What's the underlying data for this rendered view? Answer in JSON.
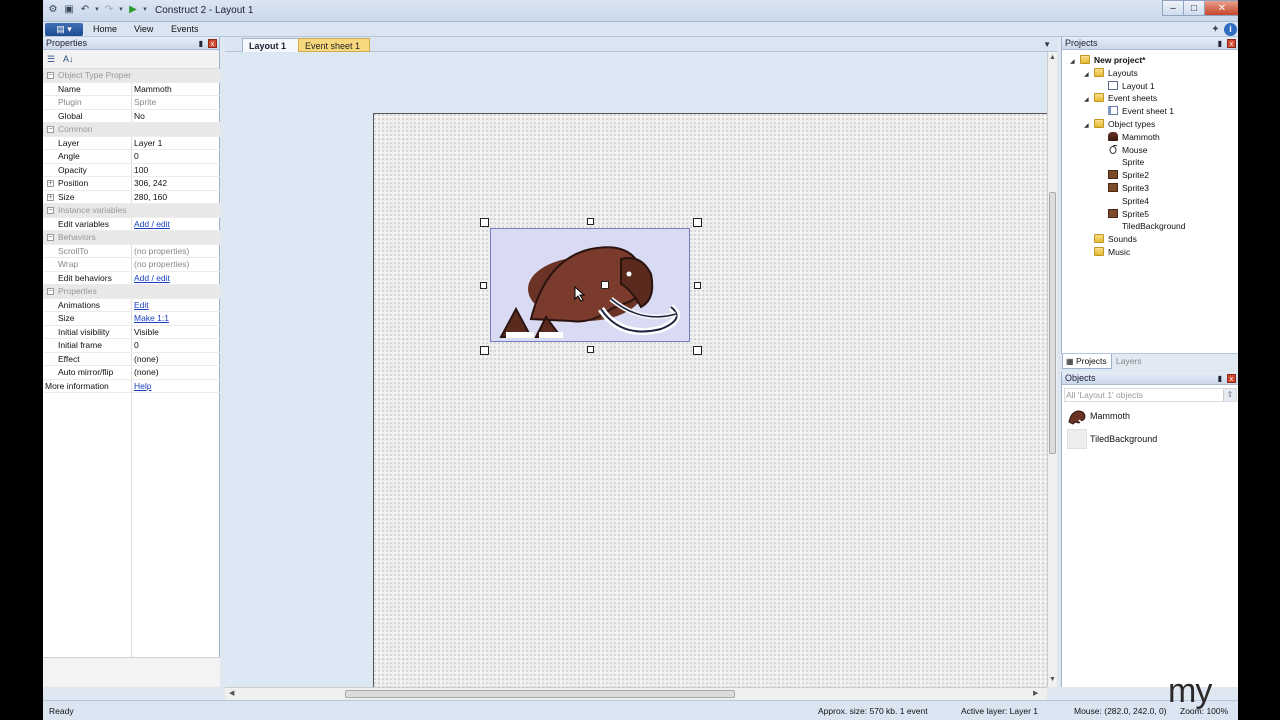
{
  "window": {
    "title": "Construct 2 - Layout 1",
    "controls": [
      "–",
      "□",
      "✕"
    ]
  },
  "menu": {
    "file": "▤ ▾",
    "items": [
      "Home",
      "View",
      "Events"
    ]
  },
  "properties": {
    "title": "Properties",
    "rows": [
      {
        "type": "cat",
        "key": "Object Type Properties"
      },
      {
        "key": "Name",
        "value": "Mammoth"
      },
      {
        "key": "Plugin",
        "value": "Sprite",
        "dim": true
      },
      {
        "key": "Global",
        "value": "No"
      },
      {
        "type": "cat",
        "key": "Common"
      },
      {
        "key": "Layer",
        "value": "Layer 1"
      },
      {
        "key": "Angle",
        "value": "0"
      },
      {
        "key": "Opacity",
        "value": "100"
      },
      {
        "key": "Position",
        "value": "306, 242",
        "expand": true
      },
      {
        "key": "Size",
        "value": "280, 160",
        "expand": true
      },
      {
        "type": "cat",
        "key": "Instance variables"
      },
      {
        "key": "Edit variables",
        "value": "Add / edit",
        "link": true
      },
      {
        "type": "cat",
        "key": "Behaviors"
      },
      {
        "key": "ScrollTo",
        "value": "(no properties)",
        "dim": true
      },
      {
        "key": "Wrap",
        "value": "(no properties)",
        "dim": true
      },
      {
        "key": "Edit behaviors",
        "value": "Add / edit",
        "link": true
      },
      {
        "type": "cat",
        "key": "Properties"
      },
      {
        "key": "Animations",
        "value": "Edit",
        "link": true
      },
      {
        "key": "Size",
        "value": "Make 1:1",
        "link": true
      },
      {
        "key": "Initial visibility",
        "value": "Visible"
      },
      {
        "key": "Initial frame",
        "value": "0"
      },
      {
        "key": "Effect",
        "value": "(none)"
      },
      {
        "key": "Auto mirror/flip",
        "value": "(none)"
      },
      {
        "key": "More information",
        "value": "Help",
        "link": true,
        "wide": true
      }
    ]
  },
  "tabs": [
    {
      "label": "Layout 1",
      "active": true
    },
    {
      "label": "Event sheet 1",
      "active": false
    }
  ],
  "projects": {
    "title": "Projects",
    "tree": [
      {
        "label": "New project*",
        "level": 0,
        "icon": "folder",
        "bold": true,
        "expanded": true
      },
      {
        "label": "Layouts",
        "level": 1,
        "icon": "folder",
        "expanded": true
      },
      {
        "label": "Layout 1",
        "level": 2,
        "icon": "page"
      },
      {
        "label": "Event sheets",
        "level": 1,
        "icon": "folder",
        "expanded": true
      },
      {
        "label": "Event sheet 1",
        "level": 2,
        "icon": "sheet"
      },
      {
        "label": "Object types",
        "level": 1,
        "icon": "folder",
        "expanded": true
      },
      {
        "label": "Mammoth",
        "level": 2,
        "icon": "mammoth"
      },
      {
        "label": "Mouse",
        "level": 2,
        "icon": "mouse"
      },
      {
        "label": "Sprite",
        "level": 2,
        "icon": "blank"
      },
      {
        "label": "Sprite2",
        "level": 2,
        "icon": "spr"
      },
      {
        "label": "Sprite3",
        "level": 2,
        "icon": "spr"
      },
      {
        "label": "Sprite4",
        "level": 2,
        "icon": "blank"
      },
      {
        "label": "Sprite5",
        "level": 2,
        "icon": "spr"
      },
      {
        "label": "TiledBackground",
        "level": 2,
        "icon": "blank"
      },
      {
        "label": "Sounds",
        "level": 1,
        "icon": "folder"
      },
      {
        "label": "Music",
        "level": 1,
        "icon": "folder"
      }
    ],
    "bottom_tabs": [
      "Projects",
      "Layers"
    ]
  },
  "objects": {
    "title": "Objects",
    "filter": "All 'Layout 1' objects",
    "items": [
      "Mammoth",
      "TiledBackground"
    ]
  },
  "status": {
    "ready": "Ready",
    "size": "Approx. size: 570 kb. 1 event",
    "layer": "Active layer: Layer 1",
    "mouse": "Mouse: (282.0, 242.0, 0)",
    "zoom": "Zoom: 100%"
  },
  "watermark": "my"
}
